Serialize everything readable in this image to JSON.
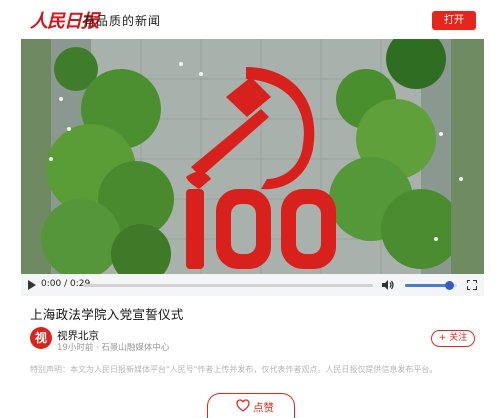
{
  "header": {
    "logo_text": "人民日报",
    "slogan": "有品质的新闻",
    "open_label": "打开"
  },
  "video": {
    "description_icon": "video-frame",
    "current_time": "0:00 / 0:29",
    "progress": 0.0,
    "volume": 0.85
  },
  "article": {
    "title": "上海政法学院入党宣誓仪式",
    "author": {
      "avatar_text": "视",
      "name": "视界北京",
      "meta": "19小时前 · 石景山融媒体中心"
    },
    "follow_label": "+ 关注",
    "disclaimer": "特别声明：本文为人民日报新媒体平台\"人民号\"作者上传并发布，仅代表作者观点。人民日报仅提供信息发布平台。"
  },
  "actions": {
    "like_label": "点赞"
  },
  "colors": {
    "brand_red": "#e5261d",
    "volume_blue": "#4a7bd4"
  }
}
